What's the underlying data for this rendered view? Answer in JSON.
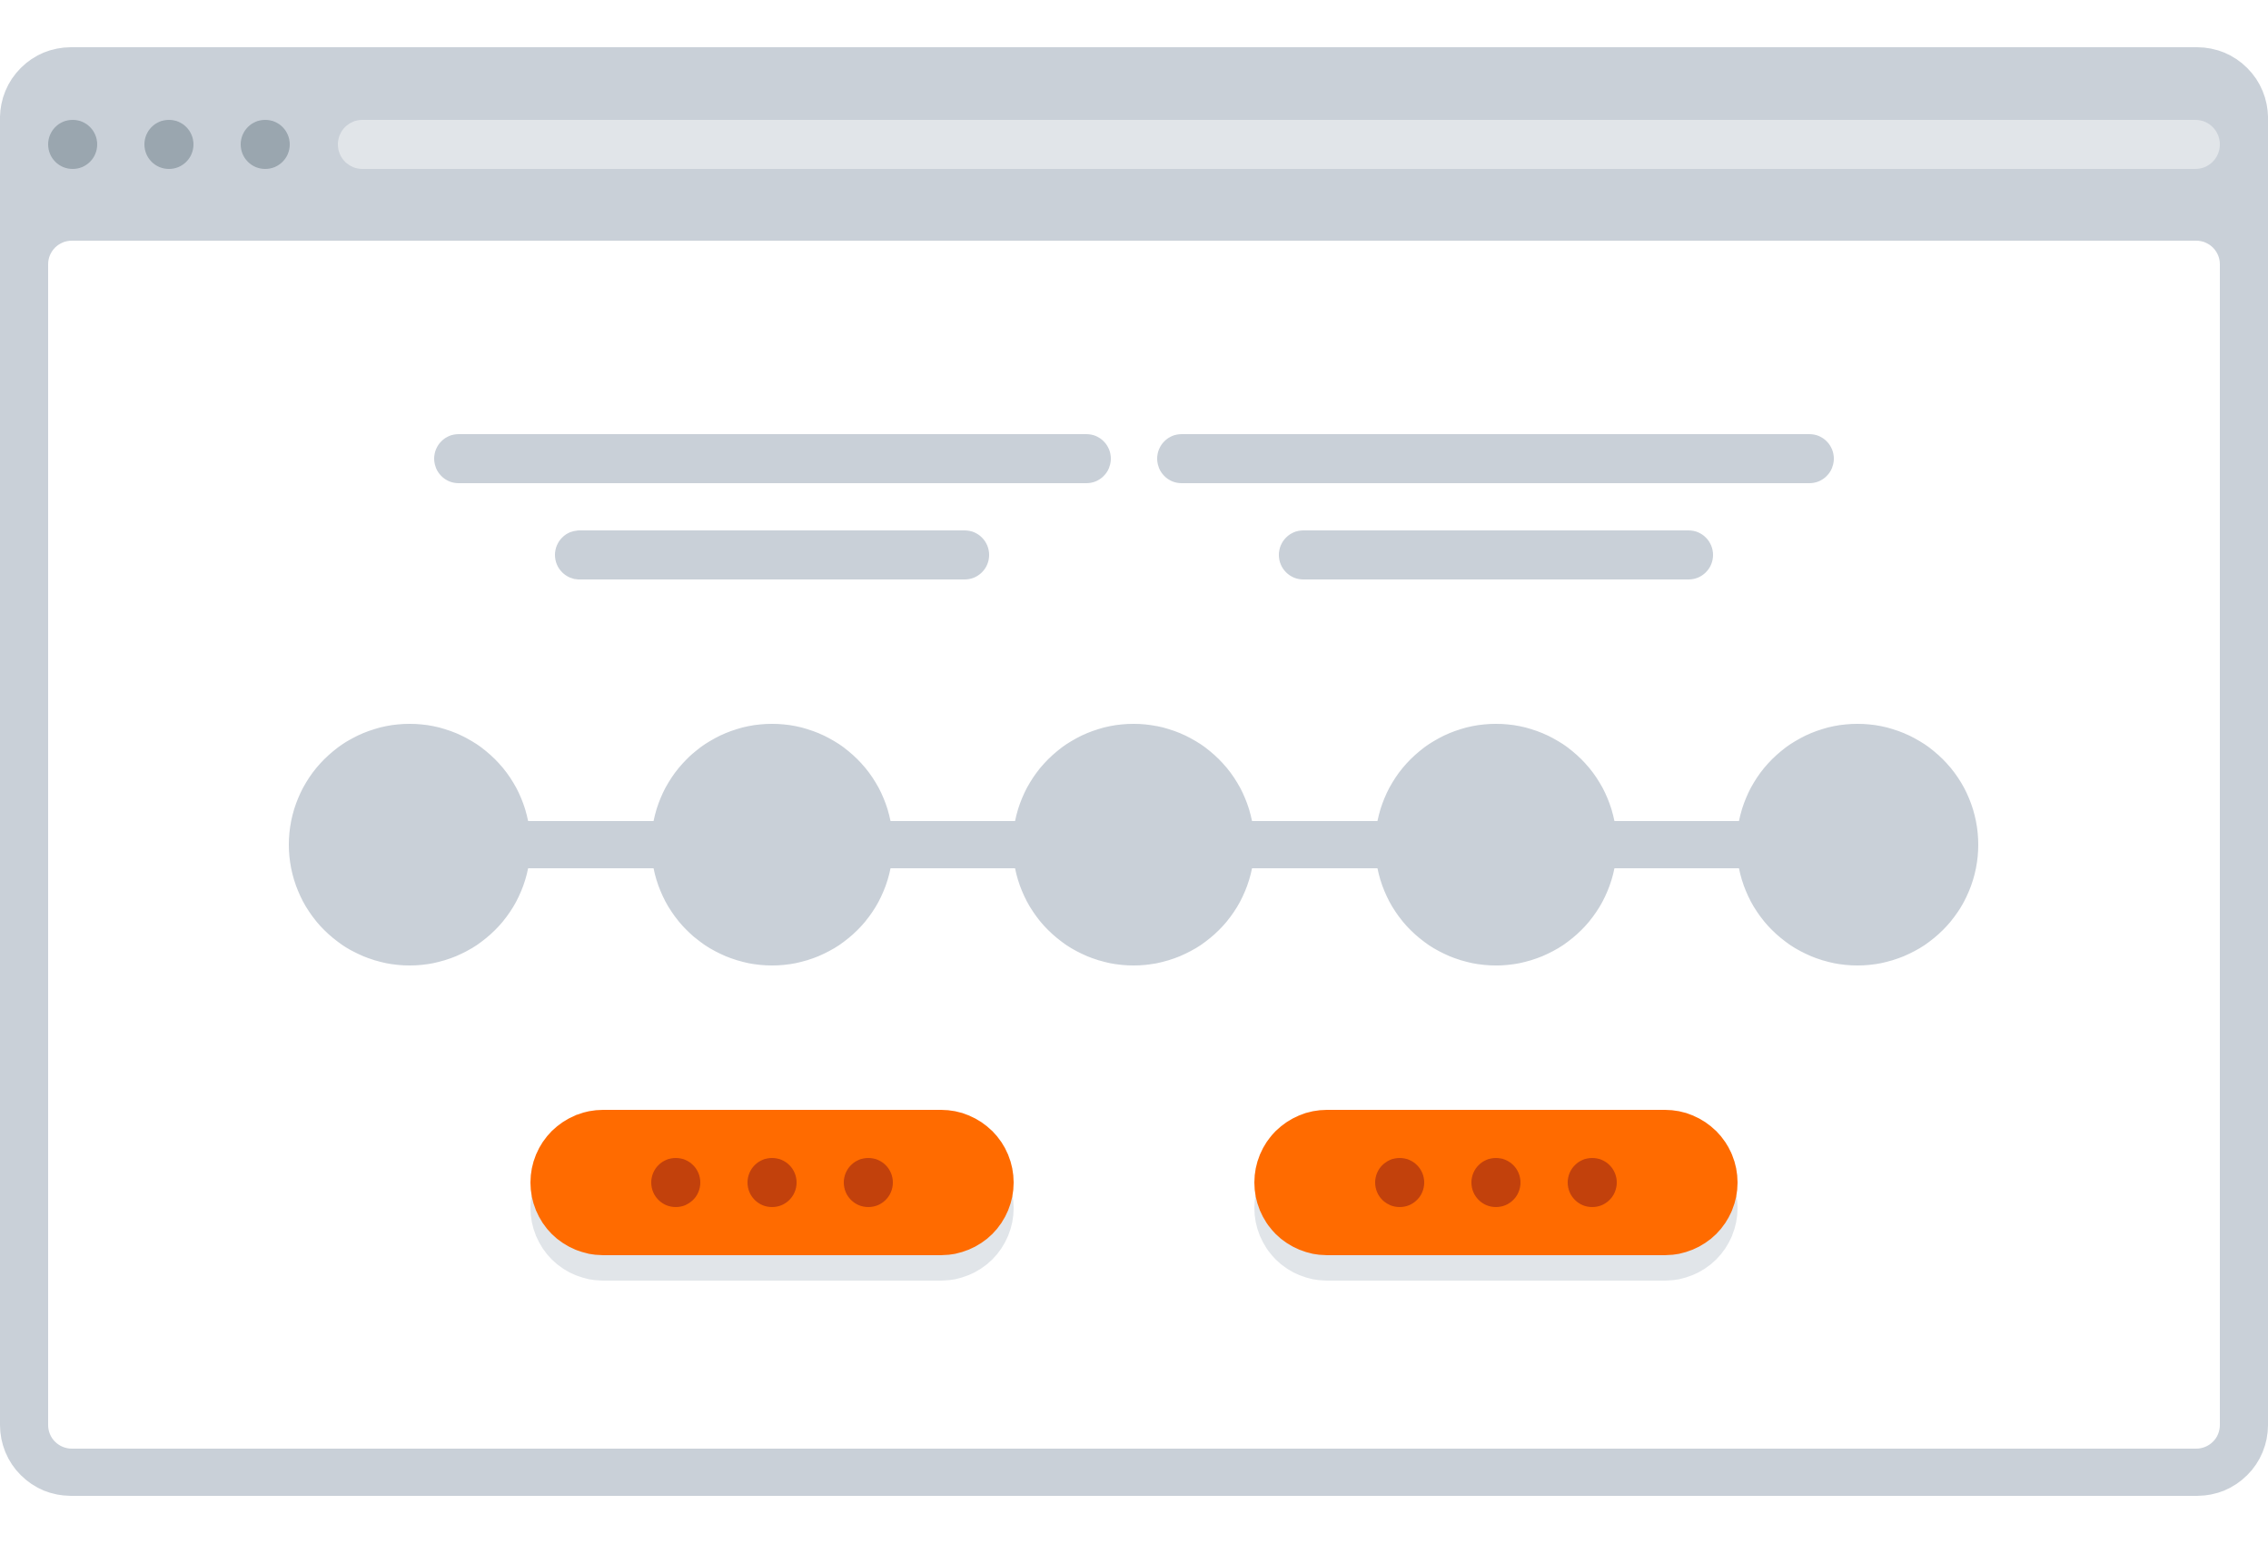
{
  "window": {
    "frame_color": "#C9D0D8",
    "content_color": "#FFFFFF",
    "control_dot_color": "#9AA6AF",
    "address_bar_color": "#E1E5E9",
    "control_dots": [
      "close-dot",
      "minimize-dot",
      "maximize-dot"
    ]
  },
  "placeholders": {
    "color": "#C9D0D8",
    "rows": 2,
    "columns": 2
  },
  "stepper": {
    "step_count": 5,
    "color": "#C9D0D8"
  },
  "buttons": {
    "count": 2,
    "fill_color": "#FF6B00",
    "shadow_color": "#E1E5E9",
    "dot_color": "#C2410C",
    "icon": "more-dots-icon"
  }
}
